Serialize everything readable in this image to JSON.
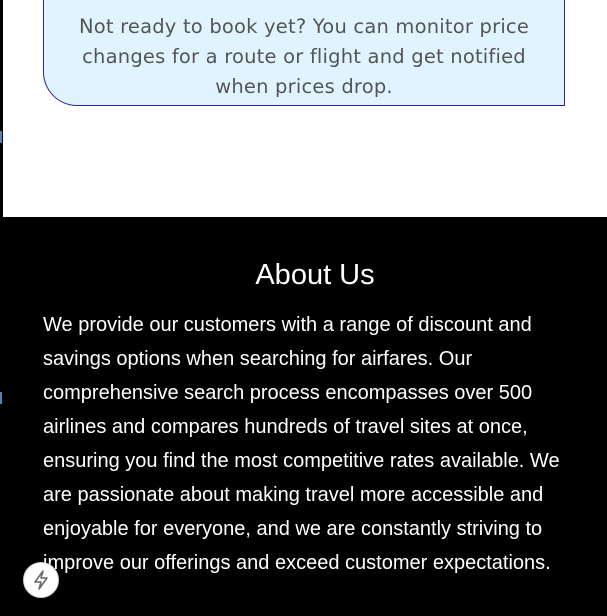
{
  "price_alert": {
    "text": "Not ready to book yet? You can monitor price changes for a route or flight and get notified when prices drop."
  },
  "about": {
    "title": "About Us",
    "body": "We provide our customers with a range of discount and savings options when searching for airfares. Our comprehensive search process encompasses over 500 airlines and compares hundreds of travel sites at once, ensuring you find the most competitive rates available. We are passionate about making travel more accessible and enjoyable for everyone, and we are constantly striving to improve our offerings and exceed customer expectations."
  },
  "floating_button": {
    "icon": "lightning-bolt-icon"
  },
  "colors": {
    "alert_background": "#e0f4ff",
    "alert_border": "#2a1fb0",
    "alert_text": "#555555",
    "about_background": "#000000",
    "about_text": "#ffffff"
  }
}
